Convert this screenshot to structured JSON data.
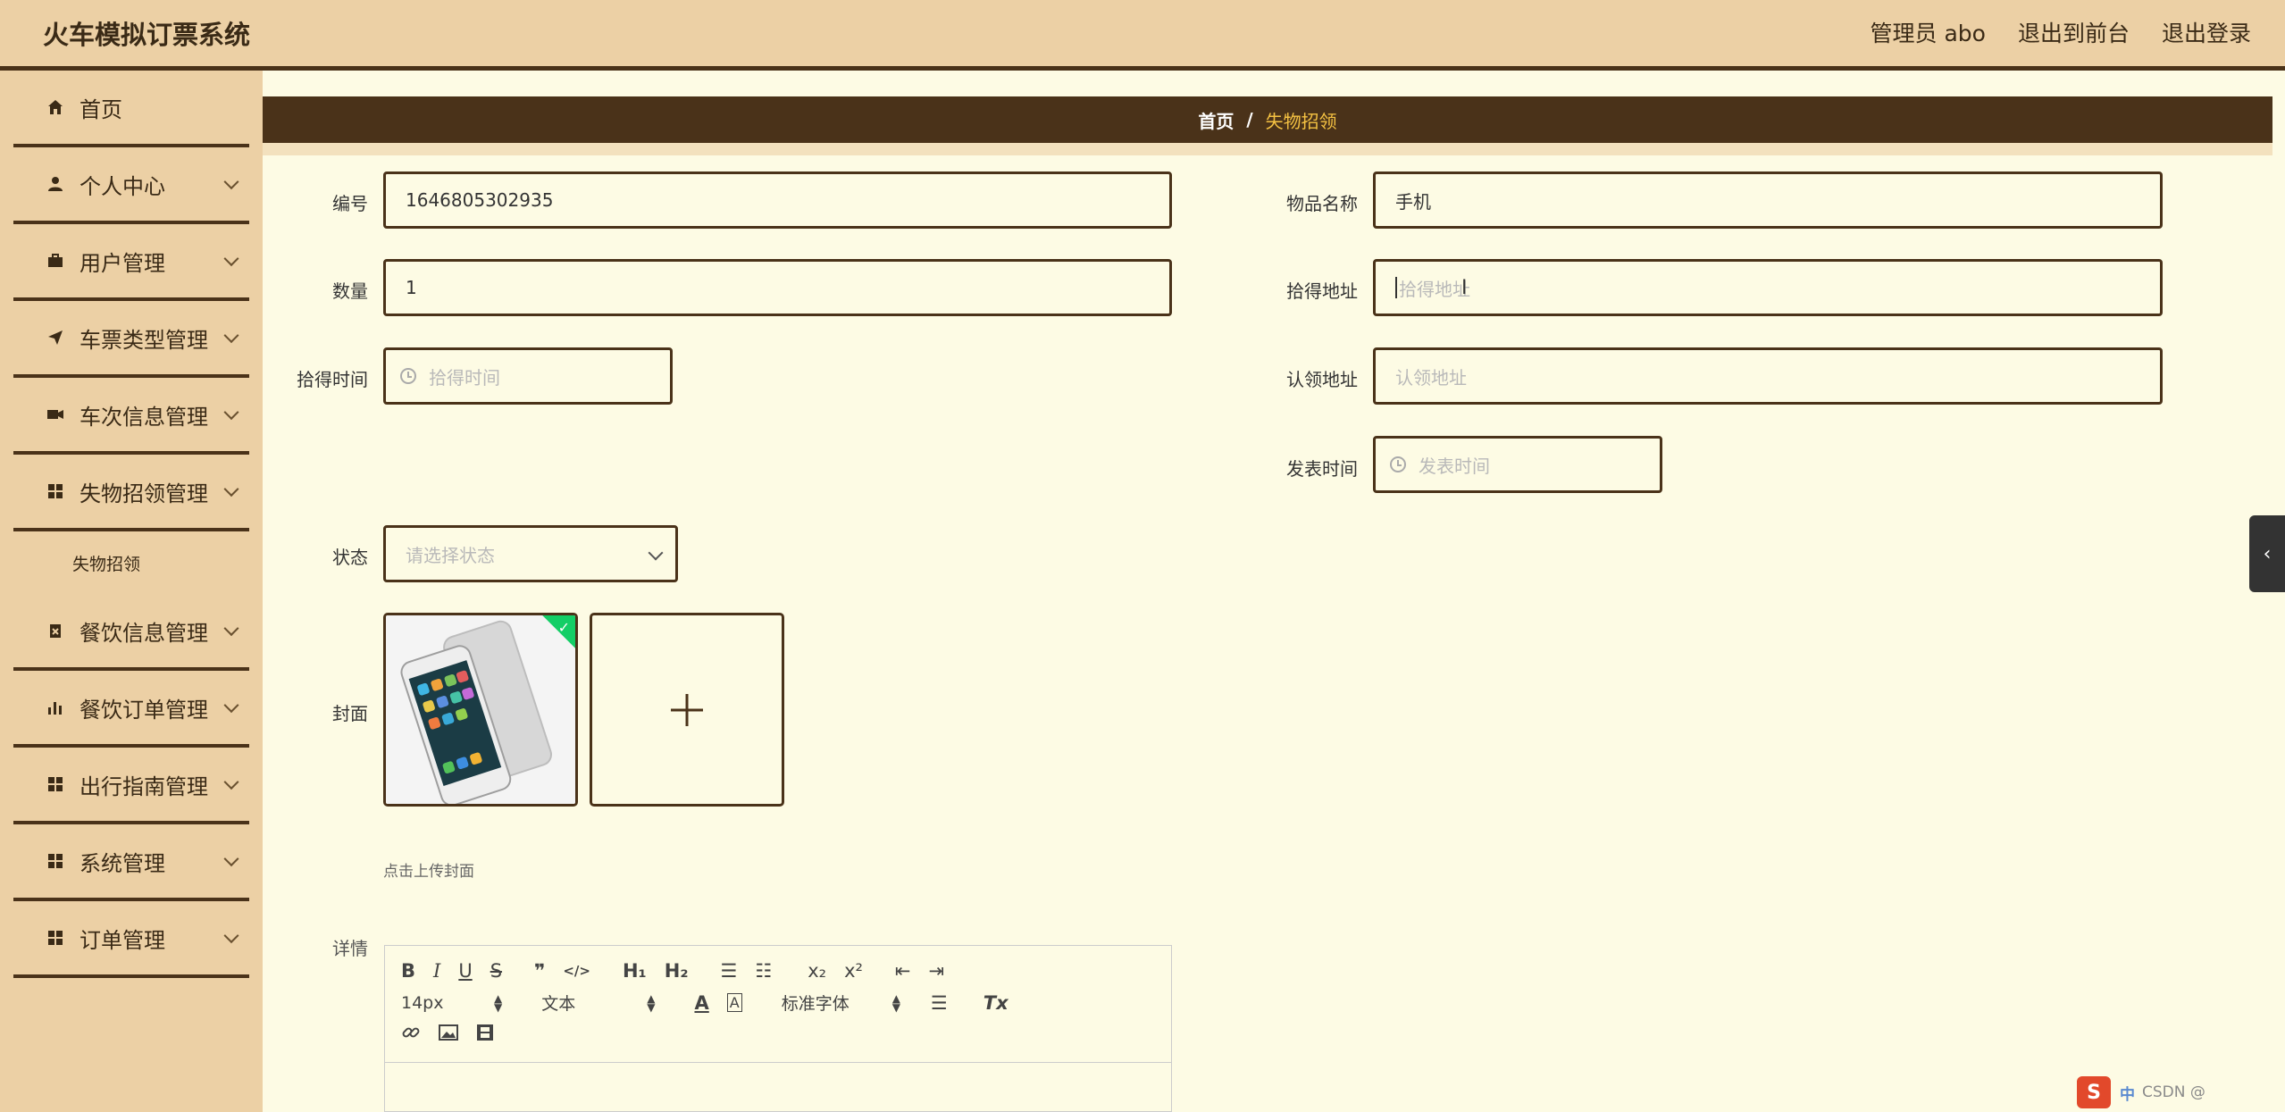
{
  "app": {
    "title": "火车模拟订票系统",
    "admin_label": "管理员 abo",
    "frontend_link": "退出到前台",
    "logout_link": "退出登录"
  },
  "sidebar": {
    "items": [
      {
        "label": "首页",
        "icon": "home-icon"
      },
      {
        "label": "个人中心",
        "icon": "user-icon"
      },
      {
        "label": "用户管理",
        "icon": "briefcase-icon"
      },
      {
        "label": "车票类型管理",
        "icon": "send-icon"
      },
      {
        "label": "车次信息管理",
        "icon": "ticket-icon"
      },
      {
        "label": "失物招领管理",
        "icon": "grid-icon"
      },
      {
        "label": "餐饮信息管理",
        "icon": "clipboard-icon"
      },
      {
        "label": "餐饮订单管理",
        "icon": "bar-chart-icon"
      },
      {
        "label": "出行指南管理",
        "icon": "grid-icon"
      },
      {
        "label": "系统管理",
        "icon": "grid-icon"
      },
      {
        "label": "订单管理",
        "icon": "grid-icon"
      }
    ],
    "sub_item": "失物招领"
  },
  "breadcrumb": {
    "home": "首页",
    "separator": "/",
    "current": "失物招领"
  },
  "form": {
    "number_label": "编号",
    "number_value": "1646805302935",
    "item_name_label": "物品名称",
    "item_name_value": "手机",
    "quantity_label": "数量",
    "quantity_value": "1",
    "found_address_label": "拾得地址",
    "found_address_placeholder": "拾得地址",
    "found_time_label": "拾得时间",
    "found_time_placeholder": "拾得时间",
    "claim_address_label": "认领地址",
    "claim_address_placeholder": "认领地址",
    "publish_time_label": "发表时间",
    "publish_time_placeholder": "发表时间",
    "status_label": "状态",
    "status_placeholder": "请选择状态",
    "cover_label": "封面",
    "cover_hint": "点击上传封面",
    "detail_label": "详情"
  },
  "editor": {
    "font_size": "14px",
    "paragraph": "文本",
    "font_family": "标准字体",
    "buttons": {
      "bold": "B",
      "italic": "I",
      "underline": "U",
      "strike": "S",
      "quote": "❞",
      "code": "</>",
      "h1": "H₁",
      "h2": "H₂",
      "ordered_list": "☰",
      "bullet_list": "☷",
      "subscript": "x₂",
      "superscript": "x²",
      "outdent": "⇤",
      "indent": "⇥",
      "color": "A",
      "background": "A",
      "align": "☰",
      "clean": "Tx"
    }
  },
  "taskbar": {
    "ime": "中",
    "watermark": "CSDN @"
  },
  "colors": {
    "header_bg": "#ecd0a5",
    "dark_brown": "#4a3219",
    "content_bg": "#fdfbe4",
    "accent_yellow": "#f5c242",
    "success": "#13ce66"
  }
}
